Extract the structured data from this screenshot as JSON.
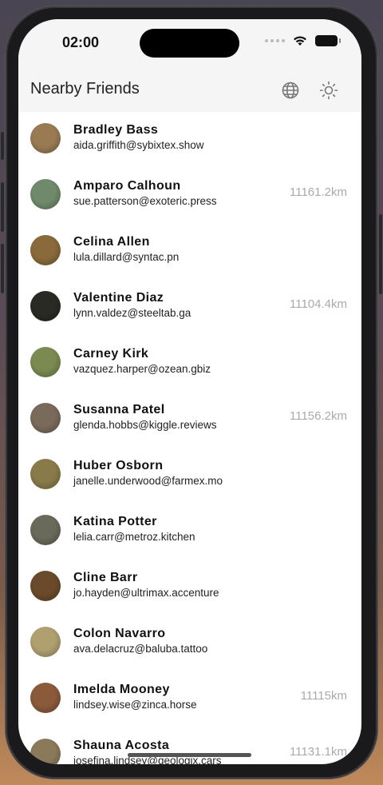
{
  "status_bar": {
    "time": "02:00"
  },
  "header": {
    "title": "Nearby Friends",
    "icons": [
      "globe-icon",
      "sun-icon"
    ]
  },
  "friends": [
    {
      "name": "Bradley Bass",
      "email": "aida.griffith@sybixtex.show",
      "distance": "",
      "avatar_color": "#9a7a52"
    },
    {
      "name": "Amparo Calhoun",
      "email": "sue.patterson@exoteric.press",
      "distance": "11161.2km",
      "avatar_color": "#6f8a6a"
    },
    {
      "name": "Celina Allen",
      "email": "lula.dillard@syntac.pn",
      "distance": "",
      "avatar_color": "#8a6a3a"
    },
    {
      "name": "Valentine Diaz",
      "email": "lynn.valdez@steeltab.ga",
      "distance": "11104.4km",
      "avatar_color": "#2a2a24"
    },
    {
      "name": "Carney Kirk",
      "email": "vazquez.harper@ozean.gbiz",
      "distance": "",
      "avatar_color": "#7a8a50"
    },
    {
      "name": "Susanna Patel",
      "email": "glenda.hobbs@kiggle.reviews",
      "distance": "11156.2km",
      "avatar_color": "#7a6a5a"
    },
    {
      "name": "Huber Osborn",
      "email": "janelle.underwood@farmex.mo",
      "distance": "",
      "avatar_color": "#8a7a4a"
    },
    {
      "name": "Katina Potter",
      "email": "lelia.carr@metroz.kitchen",
      "distance": "",
      "avatar_color": "#6a6a5a"
    },
    {
      "name": "Cline Barr",
      "email": "jo.hayden@ultrimax.accenture",
      "distance": "",
      "avatar_color": "#6a4a2a"
    },
    {
      "name": "Colon Navarro",
      "email": "ava.delacruz@baluba.tattoo",
      "distance": "",
      "avatar_color": "#b0a070"
    },
    {
      "name": "Imelda Mooney",
      "email": "lindsey.wise@zinca.horse",
      "distance": "11115km",
      "avatar_color": "#8a5a3a"
    },
    {
      "name": "Shauna Acosta",
      "email": "josefina.lindsey@geologix.cars",
      "distance": "11131.1km",
      "avatar_color": "#8a7a5a"
    }
  ]
}
